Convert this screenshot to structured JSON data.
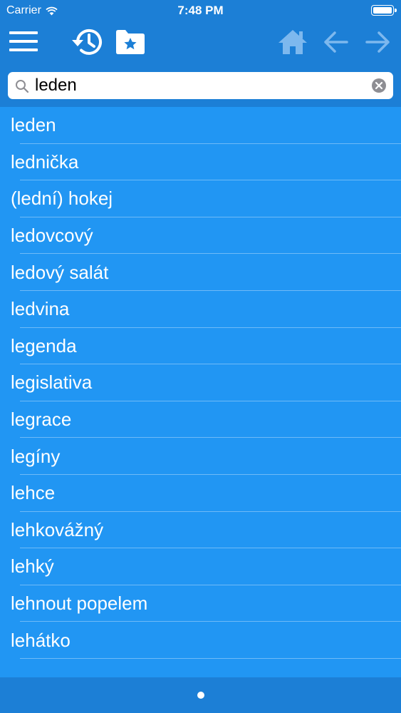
{
  "status_bar": {
    "carrier": "Carrier",
    "time": "7:48 PM"
  },
  "toolbar": {
    "icons": [
      "menu-icon",
      "history-icon",
      "favorites-folder-icon",
      "home-icon",
      "back-arrow-icon",
      "forward-arrow-icon"
    ]
  },
  "search": {
    "value": "leden",
    "placeholder": ""
  },
  "words": [
    "leden",
    "lednička",
    "(lední) hokej",
    "ledovcový",
    "ledový salát",
    "ledvina",
    "legenda",
    "legislativa",
    "legrace",
    "legíny",
    "lehce",
    "lehkovážný",
    "lehký",
    "lehnout popelem",
    "lehátko"
  ],
  "colors": {
    "header": "#1c7fd6",
    "list_background": "#2196f3",
    "icon_active": "#ffffff",
    "icon_dim": "#7db8ee"
  }
}
